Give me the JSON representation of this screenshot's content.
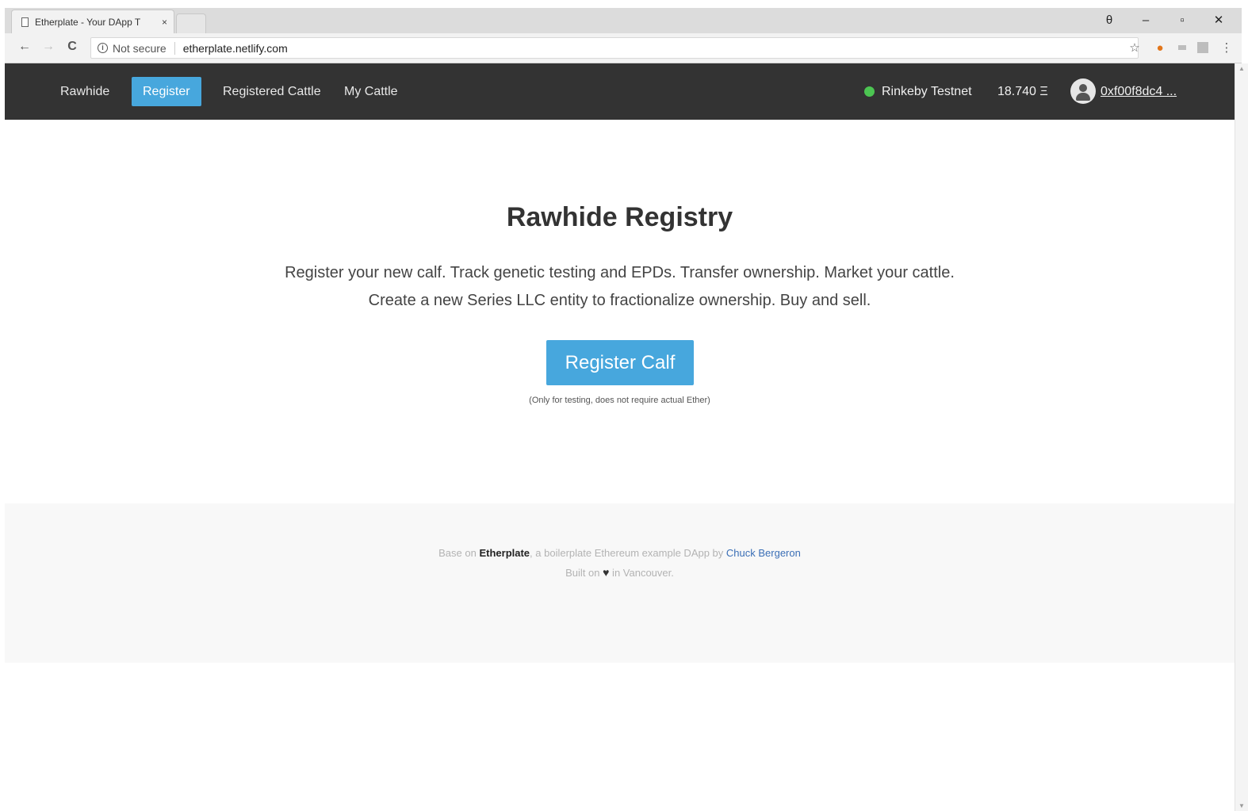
{
  "browser": {
    "tab_title": "Etherplate - Your DApp T",
    "tab_close": "×",
    "window_controls": {
      "profile": "θ",
      "minimize": "–",
      "maximize": "▫",
      "close": "✕"
    },
    "nav": {
      "back": "←",
      "forward": "→",
      "reload": "C"
    },
    "omnibox": {
      "security_label": "Not secure",
      "url": "etherplate.netlify.com"
    },
    "extensions": {
      "star": "☆",
      "fox": "🦊",
      "menu": "⋮"
    }
  },
  "navbar": {
    "items": [
      {
        "label": "Rawhide",
        "active": false
      },
      {
        "label": "Register",
        "active": true
      },
      {
        "label": "Registered Cattle",
        "active": false
      },
      {
        "label": "My Cattle",
        "active": false
      }
    ],
    "network": "Rinkeby Testnet",
    "network_status_color": "#4cc552",
    "balance": "18.740 Ξ",
    "address": "0xf00f8dc4 ..."
  },
  "hero": {
    "title": "Rawhide Registry",
    "line1": "Register your new calf. Track genetic testing and EPDs. Transfer ownership. Market your cattle.",
    "line2": "Create a new Series LLC entity to fractionalize ownership. Buy and sell.",
    "button_label": "Register Calf",
    "note": "(Only for testing, does not require actual Ether)"
  },
  "footer": {
    "prefix": "Base on ",
    "brand": "Etherplate",
    "middle": ", a boilerplate Ethereum example DApp by ",
    "author": "Chuck Bergeron",
    "built_prefix": "Built on ",
    "built_icon": "♥",
    "built_suffix": " in Vancouver."
  },
  "colors": {
    "accent": "#47a7dd",
    "navbar_bg": "#333333",
    "footer_bg": "#f8f8f8",
    "link": "#3b6fb6"
  }
}
